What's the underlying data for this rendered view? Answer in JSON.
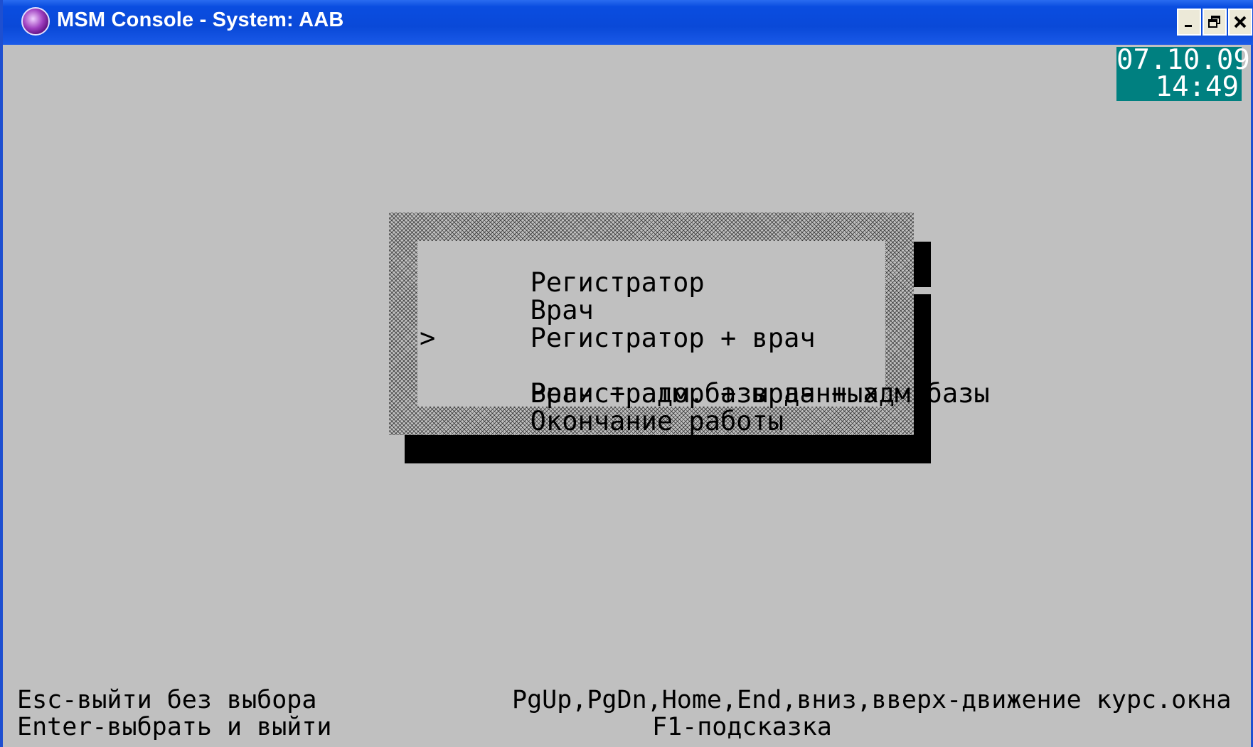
{
  "window": {
    "title": "MSM Console - System: AAB",
    "icon": "msm-console-icon",
    "controls": {
      "minimize": "_",
      "maximize": "▫",
      "close": "×"
    }
  },
  "clock": {
    "date": "07.10.09",
    "time": "14:49"
  },
  "menu": {
    "items": [
      {
        "label": "Регистратор",
        "selected": false
      },
      {
        "label": "Врач",
        "selected": false
      },
      {
        "label": "Регистратор + врач",
        "selected": false
      },
      {
        "label": "Регистратор + врач + адм.базы",
        "selected": true
      },
      {
        "label": "Врач + адм.базы данных",
        "selected": false
      },
      {
        "label": "Окончание работы",
        "selected": false
      }
    ],
    "pointer": ">"
  },
  "status": {
    "esc": "Esc-выйти без выбора",
    "enter": "Enter-выбрать и выйти",
    "navigation": "PgUp,PgDn,Home,End,вниз,вверх-движение курс.окна",
    "help": "F1-подсказка"
  },
  "colors": {
    "background": "#c0c0c0",
    "titlebar": "#0a49d8",
    "clock_bg": "#008080"
  }
}
